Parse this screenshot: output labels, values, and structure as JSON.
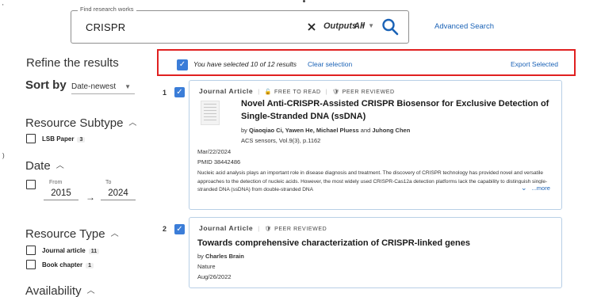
{
  "search": {
    "legend": "Find research works",
    "query": "CRISPR",
    "filter_outputs": "Outputs",
    "filter_all": "All",
    "advanced_link": "Advanced Search"
  },
  "sidebar": {
    "refine_title": "Refine the results",
    "sort_label": "Sort by",
    "sort_value": "Date-newest",
    "resource_subtype": {
      "title": "Resource Subtype",
      "items": [
        {
          "label": "LSB Paper",
          "count": "3"
        }
      ]
    },
    "date": {
      "title": "Date",
      "from_label": "From",
      "from_value": "2015",
      "to_label": "To",
      "to_value": "2024"
    },
    "resource_type": {
      "title": "Resource Type",
      "items": [
        {
          "label": "Journal article",
          "count": "11"
        },
        {
          "label": "Book chapter",
          "count": "1"
        }
      ]
    },
    "availability": {
      "title": "Availability"
    }
  },
  "selection_bar": {
    "text": "You have selected 10 of 12 results",
    "clear": "Clear selection",
    "export": "Export Selected"
  },
  "results": [
    {
      "number": "1",
      "type": "Journal Article",
      "badges": [
        "FREE TO READ",
        "PEER REVIEWED"
      ],
      "title": "Novel Anti-CRISPR-Assisted CRISPR Biosensor for Exclusive Detection of Single-Stranded DNA (ssDNA)",
      "authors_prefix": "by",
      "authors": "Qiaoqiao Ci, Yawen He, Michael Pluess",
      "authors_joiner": "and",
      "authors_last": "Juhong Chen",
      "source": "ACS sensors, Vol.9(3), p.1162",
      "date": "Mar/22/2024",
      "pmid": "PMID 38442486",
      "abstract": "Nucleic acid analysis plays an important role in disease diagnosis and treatment. The discovery of CRISPR technology has provided novel and versatile approaches to the detection of nucleic acids. However, the most widely used CRISPR-Cas12a detection platforms lack the capability to distinguish single-stranded DNA (ssDNA) from double-stranded DNA",
      "more": "...more"
    },
    {
      "number": "2",
      "type": "Journal Article",
      "badges": [
        "PEER REVIEWED"
      ],
      "title": "Towards comprehensive characterization of CRISPR-linked genes",
      "authors_prefix": "by",
      "authors": "Charles Brain",
      "source": "Nature",
      "date": "Aug/26/2022"
    }
  ],
  "colors": {
    "accent": "#1a62b6",
    "checkbox": "#3b7dd8",
    "highlight_border": "#e02020",
    "card_border": "#b8cfe6"
  },
  "icons": [
    "close-icon",
    "search-icon",
    "chevron-down-icon",
    "chevron-up-icon",
    "check-icon",
    "unlock-icon",
    "shield-icon"
  ]
}
